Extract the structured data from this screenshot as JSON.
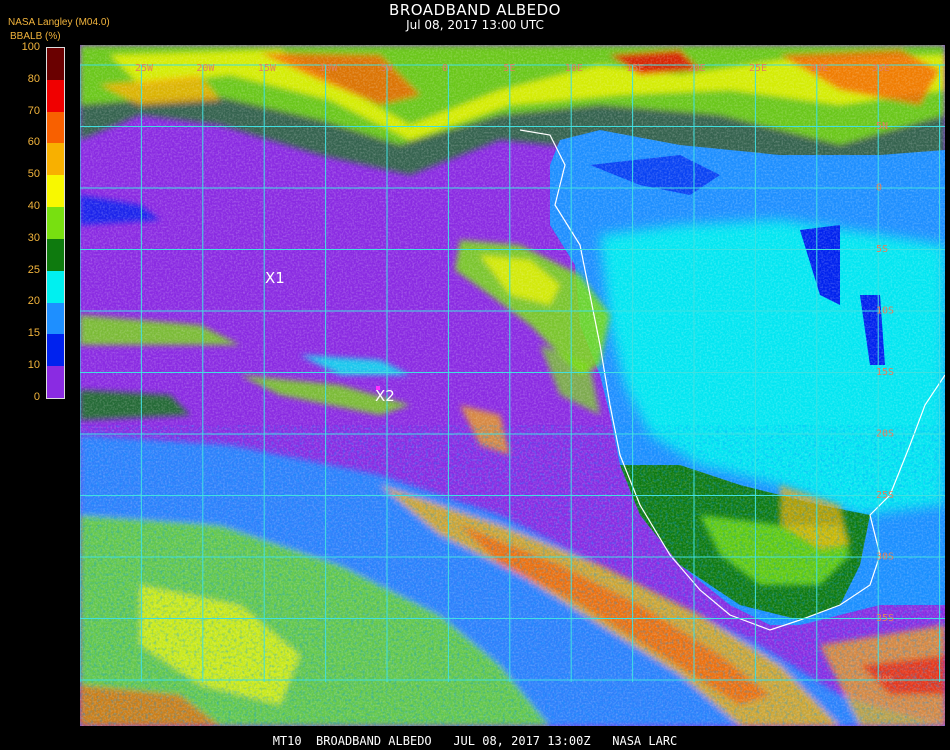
{
  "header": {
    "title": "BROADBAND ALBEDO",
    "subtitle": "Jul 08, 2017 13:00 UTC",
    "agency": "NASA Langley (M04.0)",
    "variable_label": "BBALB (%)"
  },
  "colorbar": {
    "ticks": [
      "100",
      "80",
      "70",
      "60",
      "50",
      "40",
      "30",
      "25",
      "20",
      "15",
      "10",
      "0"
    ],
    "bins": [
      {
        "range": "0-10",
        "color": "#8a2be2"
      },
      {
        "range": "10-15",
        "color": "#0022ee"
      },
      {
        "range": "15-20",
        "color": "#1e8fff"
      },
      {
        "range": "20-25",
        "color": "#00f0f0"
      },
      {
        "range": "25-30",
        "color": "#0e7a0e"
      },
      {
        "range": "30-40",
        "color": "#78e010"
      },
      {
        "range": "40-50",
        "color": "#f8f800"
      },
      {
        "range": "50-60",
        "color": "#f8b000"
      },
      {
        "range": "60-70",
        "color": "#f86000"
      },
      {
        "range": "70-80",
        "color": "#f00000"
      },
      {
        "range": "80-100",
        "color": "#6a0000"
      }
    ]
  },
  "map": {
    "grid_color": "#40e0e0",
    "coast_color": "#ffffff",
    "markers": [
      "X1",
      "X2"
    ],
    "lon_labels": [
      "25W",
      "20W",
      "15W",
      "10W",
      "5W",
      "0",
      "5E",
      "10E",
      "15E",
      "20E",
      "25E",
      "30E",
      "35E"
    ],
    "lat_labels": [
      "5N",
      "0",
      "5S",
      "10S",
      "15S",
      "20S",
      "25S",
      "30S",
      "35S",
      "40S"
    ]
  },
  "footer": "MT10  BROADBAND ALBEDO   JUL 08, 2017 13:00Z   NASA LARC"
}
